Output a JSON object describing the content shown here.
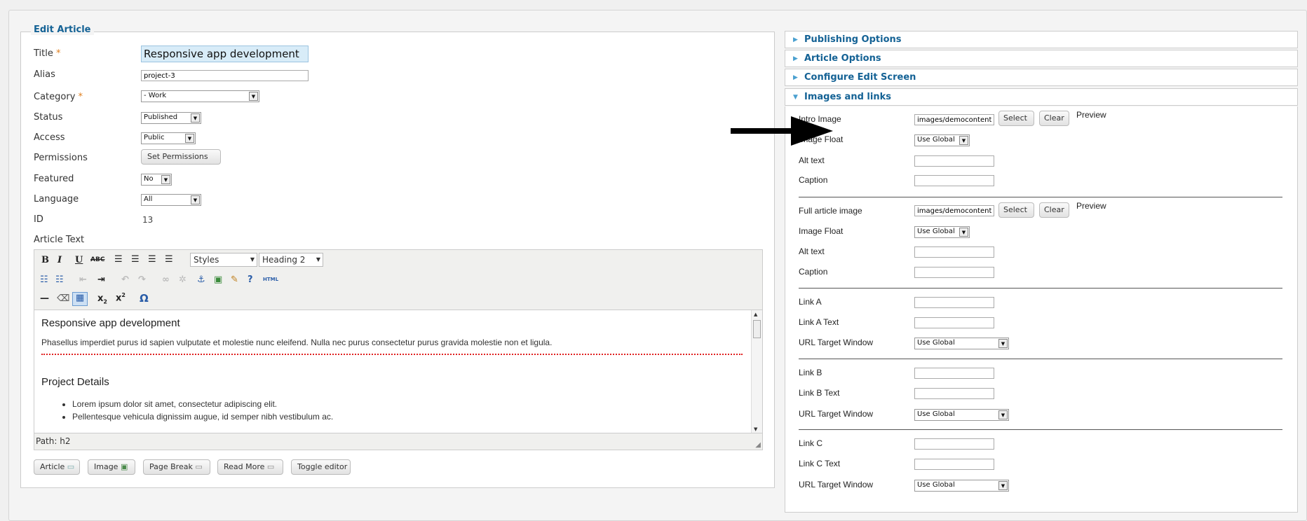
{
  "form": {
    "legend": "Edit Article",
    "title_label": "Title",
    "title_value": "Responsive app development",
    "alias_label": "Alias",
    "alias_value": "project-3",
    "category_label": "Category",
    "category_value": "- Work",
    "status_label": "Status",
    "status_value": "Published",
    "access_label": "Access",
    "access_value": "Public",
    "permissions_label": "Permissions",
    "permissions_button": "Set Permissions",
    "featured_label": "Featured",
    "featured_value": "No",
    "language_label": "Language",
    "language_value": "All",
    "id_label": "ID",
    "id_value": "13",
    "article_text_label": "Article Text",
    "required_mark": "*"
  },
  "editor": {
    "styles_select": "Styles",
    "format_select": "Heading 2",
    "heading": "Responsive app development",
    "paragraph": "Phasellus imperdiet purus id sapien vulputate et molestie nunc eleifend. Nulla nec purus consectetur purus gravida molestie non et ligula.",
    "subheading": "Project Details",
    "bullets": [
      "Lorem ipsum dolor sit amet, consectetur adipiscing elit.",
      "Pellentesque vehicula dignissim augue, id semper nibh vestibulum ac."
    ],
    "path": "Path: h2",
    "toolbar_buttons": [
      "bold-icon",
      "italic-icon",
      "underline-icon",
      "strikethrough-icon",
      "align-left-icon",
      "align-center-icon",
      "align-right-icon",
      "justify-icon",
      "bullet-list-icon",
      "numbered-list-icon",
      "outdent-icon",
      "indent-icon",
      "undo-icon",
      "redo-icon",
      "link-icon",
      "unlink-icon",
      "anchor-icon",
      "image-icon",
      "cleanup-icon",
      "help-icon",
      "html-icon",
      "horizontal-rule-icon",
      "eraser-icon",
      "table-icon",
      "subscript-icon",
      "superscript-icon",
      "omega-icon"
    ]
  },
  "editor_buttons": [
    "Article",
    "Image",
    "Page Break",
    "Read More",
    "Toggle editor"
  ],
  "panels": {
    "publishing": "Publishing Options",
    "article": "Article Options",
    "configure": "Configure Edit Screen",
    "images": "Images and links"
  },
  "images": {
    "intro_label": "Intro Image",
    "intro_value": "images/democontent/d",
    "image_float_label": "Image Float",
    "image_float_value": "Use Global",
    "alt_label": "Alt text",
    "caption_label": "Caption",
    "full_label": "Full article image",
    "full_value": "images/democontent/fa",
    "select_button": "Select",
    "clear_button": "Clear",
    "preview_label": "Preview"
  },
  "links": {
    "link_a_label": "Link A",
    "link_a_text_label": "Link A Text",
    "link_b_label": "Link B",
    "link_b_text_label": "Link B Text",
    "link_c_label": "Link C",
    "link_c_text_label": "Link C Text",
    "target_label": "URL Target Window",
    "target_value": "Use Global"
  },
  "colors": {
    "accent": "#146295",
    "title_bg": "#d8ecf8",
    "spell_underline": "#e02020"
  }
}
